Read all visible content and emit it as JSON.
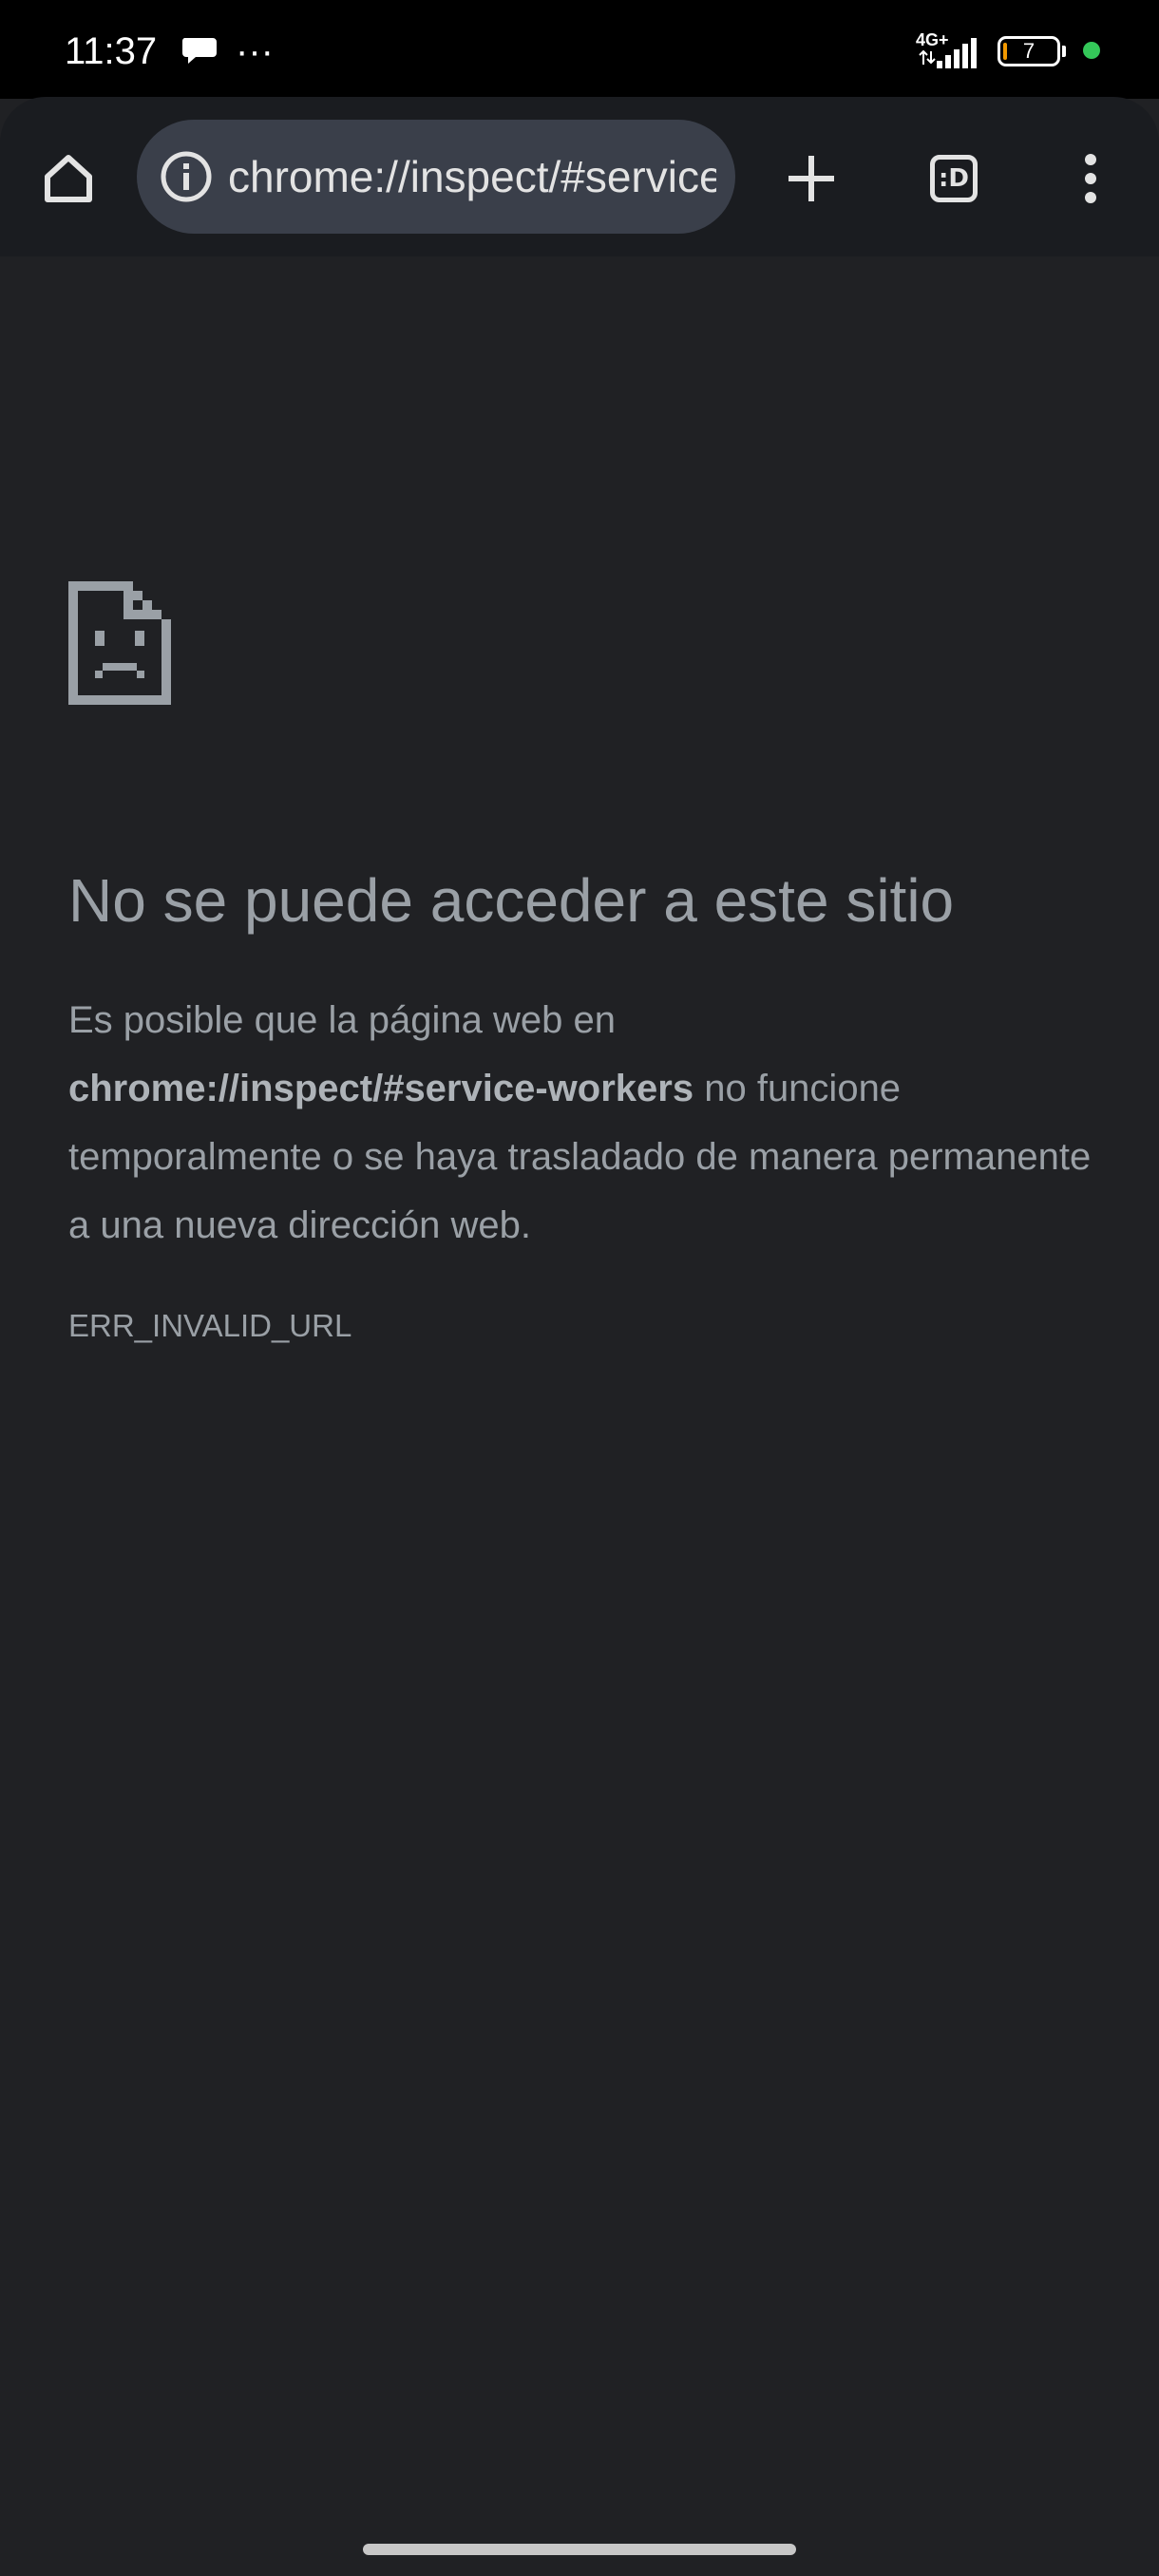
{
  "status_bar": {
    "time": "11:37",
    "overflow_dots": "···",
    "network_type": "4G+",
    "battery_level": "7",
    "battery_fraction": 0.07,
    "icons": [
      "chat-bubble-icon",
      "signal-icon",
      "battery-icon",
      "privacy-dot-icon"
    ],
    "colors": {
      "privacy_dot": "#34c759",
      "battery_low": "#f29900"
    }
  },
  "toolbar": {
    "url": "chrome://inspect/#service-workers",
    "tab_switcher_label": ":D",
    "icons": [
      "home-icon",
      "info-icon",
      "plus-icon",
      "tab-switcher-icon",
      "more-vert-icon"
    ]
  },
  "error_page": {
    "icon": "sad-page-icon",
    "heading": "No se puede acceder a este sitio",
    "body_before": "Es posible que la página web en",
    "body_url": "chrome://inspect/#service-workers",
    "body_after": "no funcione temporalmente o se haya trasladado de manera permanente a una nueva dirección web.",
    "error_code": "ERR_INVALID_URL"
  },
  "colors": {
    "page_background": "#202124",
    "toolbar_background": "#1a1c20",
    "omnibox_background": "#3a3f4a",
    "text_secondary": "#9aa0a6"
  }
}
